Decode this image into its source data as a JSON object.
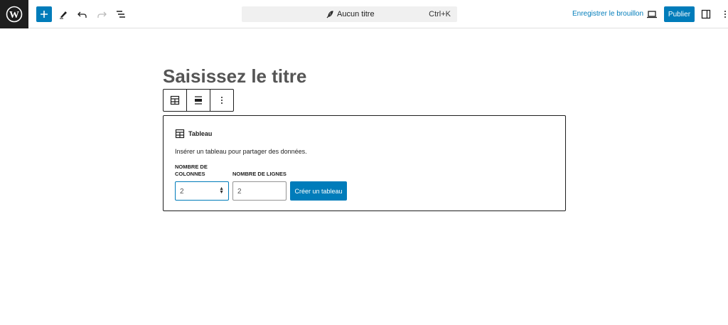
{
  "header": {
    "command_title": "Aucun titre",
    "shortcut": "Ctrl+K",
    "save_draft": "Enregistrer le brouillon",
    "publish": "Publier"
  },
  "editor": {
    "title_placeholder": "Saisissez le titre"
  },
  "table_block": {
    "label": "Tableau",
    "description": "Insérer un tableau pour partager des données.",
    "columns_label": "Nombre de colonnes",
    "rows_label": "Nombre de lignes",
    "columns_value": "2",
    "rows_value": "2",
    "create_button": "Créer un tableau"
  },
  "colors": {
    "accent": "#007cba"
  }
}
